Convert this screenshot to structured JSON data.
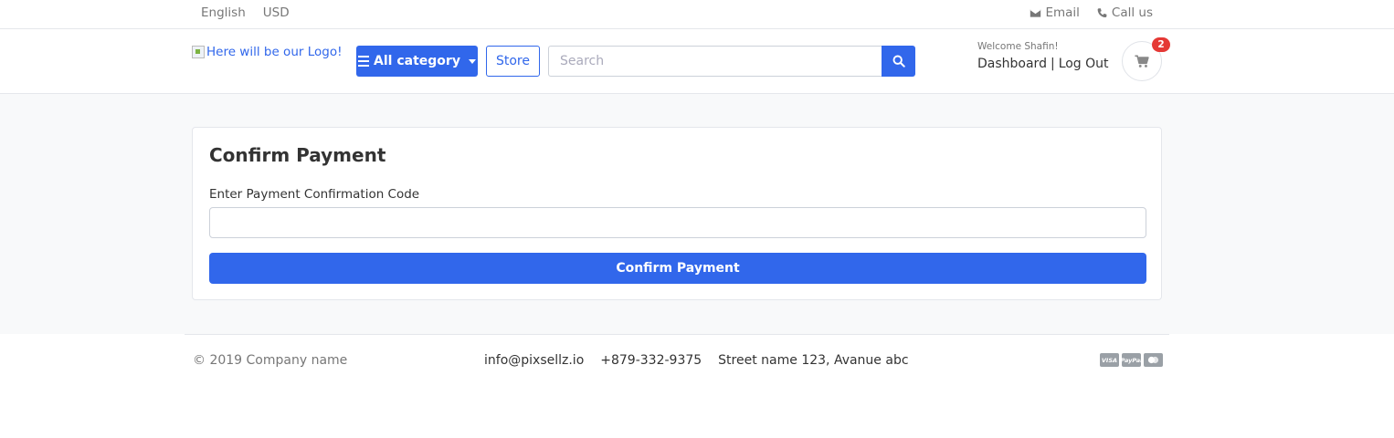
{
  "topbar": {
    "language": "English",
    "currency": "USD",
    "email_label": "Email",
    "call_label": "Call us"
  },
  "header": {
    "logo_alt": "Here will be our Logo!",
    "category_button": "All category",
    "store_button": "Store",
    "search_placeholder": "Search",
    "welcome": "Welcome Shafin!",
    "dashboard_link": "Dashboard",
    "separator": "|",
    "logout_link": "Log Out",
    "cart_count": "2"
  },
  "main": {
    "title": "Confirm Payment",
    "field_label": "Enter Payment Confirmation Code",
    "field_value": "",
    "submit_label": "Confirm Payment"
  },
  "footer": {
    "copyright": "© 2019 Company name",
    "email": "info@pixsellz.io",
    "phone": "+879-332-9375",
    "address": "Street name 123, Avanue abc",
    "payment_icons": [
      "VISA",
      "PayPal",
      "MC"
    ]
  },
  "colors": {
    "primary": "#3167eb",
    "badge": "#e53935",
    "page_bg": "#f8f9fa"
  },
  "icons": {
    "email": "envelope-icon",
    "call": "phone-icon",
    "search": "search-icon",
    "cart": "cart-icon",
    "menu": "bars-icon"
  }
}
